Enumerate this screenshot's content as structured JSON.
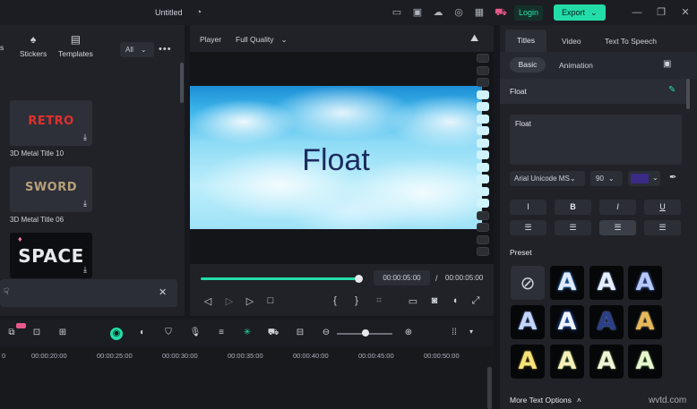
{
  "app": {
    "title": "Untitled",
    "login_label": "Login",
    "export_label": "Export",
    "accent": "#23dda9"
  },
  "left_panel": {
    "tabs": [
      {
        "label": "s"
      },
      {
        "label": "Stickers",
        "icon": "stickers-icon"
      },
      {
        "label": "Templates",
        "icon": "templates-icon"
      }
    ],
    "filter": "All",
    "items": [
      {
        "thumb_text": "RETRO",
        "label": "3D Metal Title 10"
      },
      {
        "thumb_text": "SWORD",
        "label": "3D Metal Title 06"
      },
      {
        "thumb_text": "SPACE",
        "label": ""
      }
    ]
  },
  "player": {
    "label": "Player",
    "quality": "Full Quality",
    "video_text": "Float",
    "current_time": "00:00:05:00",
    "separator": "/",
    "total_time": "00:00:05:00",
    "progress": 1.0
  },
  "right_panel": {
    "tabs": [
      "Titles",
      "Video",
      "Text To Speech"
    ],
    "subtabs": [
      "Basic",
      "Animation"
    ],
    "section_title": "Float",
    "text_value": "Float",
    "font": "Arial Unicode MS",
    "size": "90",
    "color": "#3b2a86",
    "format_buttons": [
      "I",
      "B",
      "I",
      "U"
    ],
    "preset_label": "Preset",
    "more_options": "More Text Options"
  },
  "timeline": {
    "ruler": [
      "0",
      "00:00:20:00",
      "00:00:25:00",
      "00:00:30:00",
      "00:00:35:00",
      "00:00:40:00",
      "00:00:45:00",
      "00:00:50:00"
    ]
  },
  "watermark": "wvtd.com"
}
